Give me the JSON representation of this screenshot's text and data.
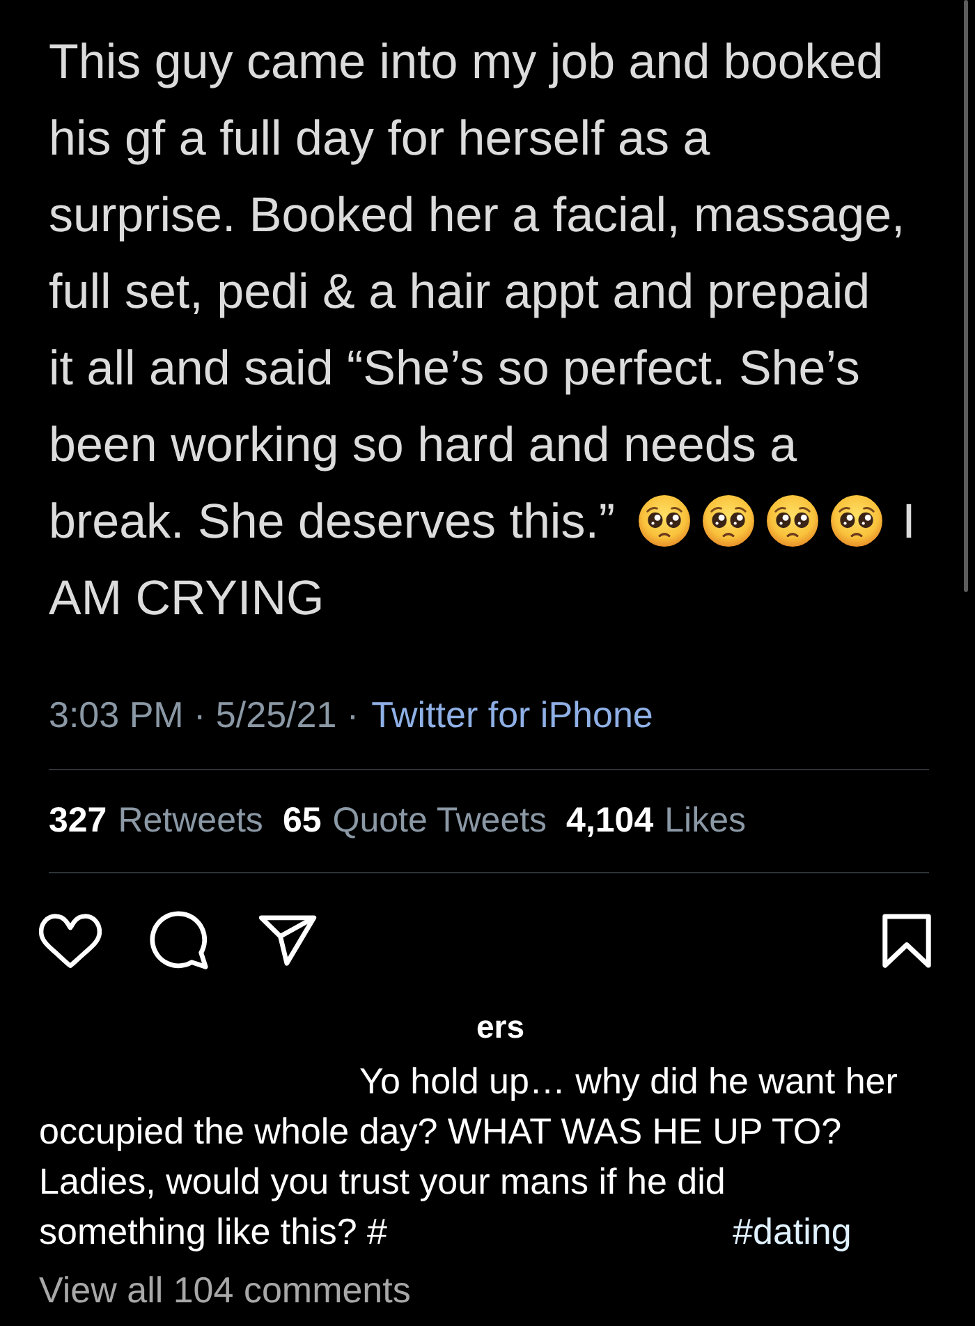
{
  "tweet": {
    "body": [
      {
        "kind": "text",
        "text": "This guy came into my job and booked\nhis gf a full day for herself as a\nsurprise. Booked her a facial, massage,\nfull set, pedi & a hair appt and prepaid\nit all and said “She’s so perfect. She’s\nbeen working so hard and needs a\nbreak. She deserves this.”"
      },
      {
        "kind": "emoji"
      },
      {
        "kind": "emoji"
      },
      {
        "kind": "emoji"
      },
      {
        "kind": "emoji"
      },
      {
        "kind": "text",
        "text": "I\nAM CRYING"
      }
    ],
    "timestamp": "3:03 PM · 5/25/21 ·",
    "source": "Twitter for iPhone",
    "stats": [
      {
        "count": "327",
        "label": "Retweets"
      },
      {
        "count": "65",
        "label": "Quote Tweets"
      },
      {
        "count": "4,104",
        "label": "Likes"
      }
    ]
  },
  "post": {
    "liked_by": "ers",
    "caption": "Yo hold up… why did he want her\noccupied the whole day? WHAT WAS HE UP TO?\nLadies, would you trust your mans if he did\nsomething like this? #",
    "hashtag": "#dating",
    "view_comments": "View all 104 comments"
  }
}
